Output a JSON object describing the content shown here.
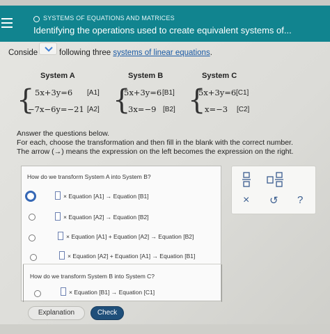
{
  "header": {
    "topic": "SYSTEMS OF EQUATIONS AND MATRICES",
    "title": "Identifying the operations used to create equivalent systems of..."
  },
  "intro": {
    "prefix": "Conside",
    "middle": "following three ",
    "link": "systems of linear equations",
    "suffix": "."
  },
  "systems": [
    {
      "name": "System A",
      "equations": [
        {
          "expr": "5x+3y=6",
          "tag": "[A1]"
        },
        {
          "expr": "−7x−6y=−21",
          "tag": "[A2]"
        }
      ]
    },
    {
      "name": "System B",
      "equations": [
        {
          "expr": "5x+3y=6",
          "tag": "[B1]"
        },
        {
          "expr": "3x=−9",
          "tag": "[B2]"
        }
      ]
    },
    {
      "name": "System C",
      "equations": [
        {
          "expr": "5x+3y=6",
          "tag": "[C1]"
        },
        {
          "expr": "x=−3",
          "tag": "[C2]"
        }
      ]
    }
  ],
  "instructions": {
    "line1": "Answer the questions below.",
    "line2": "For each, choose the transformation and then fill in the blank with the correct number.",
    "line3_a": "The arrow (",
    "line3_arrow": "→",
    "line3_b": ") means the expression on the left becomes the expression on the right."
  },
  "question1": {
    "prompt": "How do we transform System A into System B?",
    "options": [
      "× Equation [A1] → Equation [B1]",
      "× Equation [A2] → Equation [B2]",
      "× Equation [A1] + Equation [A2] → Equation [B2]",
      "× Equation [A2] + Equation [A1] → Equation [B1]"
    ]
  },
  "question2": {
    "prompt": "How do we transform System B into System C?",
    "options": [
      "× Equation [B1] → Equation [C1]"
    ]
  },
  "tools": {
    "fraction_icon": "fraction-icon",
    "mixed_number_icon": "mixed-number-icon",
    "clear": "×",
    "undo": "↺",
    "help": "?"
  },
  "buttons": {
    "explanation": "Explanation",
    "check": "Check"
  },
  "colors": {
    "header": "#11848f",
    "link": "#1a5aa5",
    "check_button": "#1f4f7a",
    "selected_radio": "#3567b5"
  }
}
